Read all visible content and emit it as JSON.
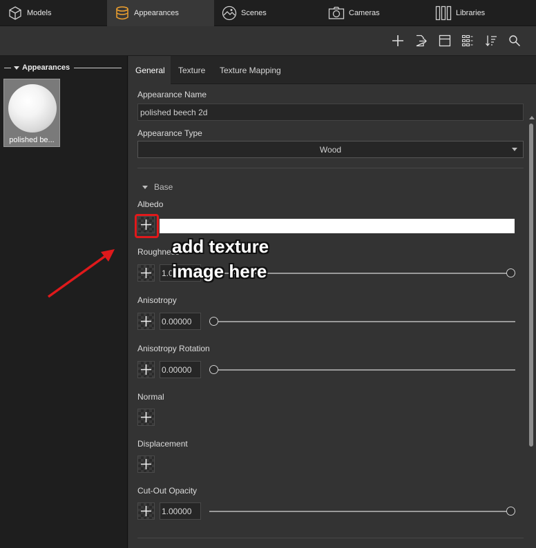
{
  "top_tabs": [
    {
      "label": "Models",
      "icon": "cube-icon"
    },
    {
      "label": "Appearances",
      "icon": "appearances-icon",
      "active": true
    },
    {
      "label": "Scenes",
      "icon": "scenes-icon"
    },
    {
      "label": "Cameras",
      "icon": "camera-icon"
    },
    {
      "label": "Libraries",
      "icon": "libraries-icon"
    }
  ],
  "toolbar": {
    "icons": [
      "add-icon",
      "export-icon",
      "layout-icon",
      "grid-view-icon",
      "sort-icon",
      "search-icon"
    ]
  },
  "left_panel": {
    "header": "Appearances",
    "items": [
      {
        "label": "polished be..."
      }
    ]
  },
  "sub_tabs": [
    {
      "label": "General",
      "active": true
    },
    {
      "label": "Texture"
    },
    {
      "label": "Texture Mapping"
    }
  ],
  "general": {
    "appearance_name_label": "Appearance Name",
    "appearance_name_value": "polished beech 2d",
    "appearance_type_label": "Appearance Type",
    "appearance_type_value": "Wood",
    "section_base": "Base",
    "albedo_label": "Albedo",
    "albedo_color": "#ffffff",
    "roughness_label": "Roughness",
    "roughness_value": "1.00000",
    "roughness_level": 1.0,
    "anisotropy_label": "Anisotropy",
    "anisotropy_value": "0.00000",
    "anisotropy_level": 0.0,
    "anisotropy_rotation_label": "Anisotropy Rotation",
    "anisotropy_rotation_value": "0.00000",
    "anisotropy_rotation_level": 0.0,
    "normal_label": "Normal",
    "displacement_label": "Displacement",
    "cutout_label": "Cut-Out Opacity",
    "cutout_value": "1.00000",
    "cutout_level": 1.0
  },
  "annotation": {
    "line1": "add texture",
    "line2": "image here",
    "color": "#e0191b"
  }
}
